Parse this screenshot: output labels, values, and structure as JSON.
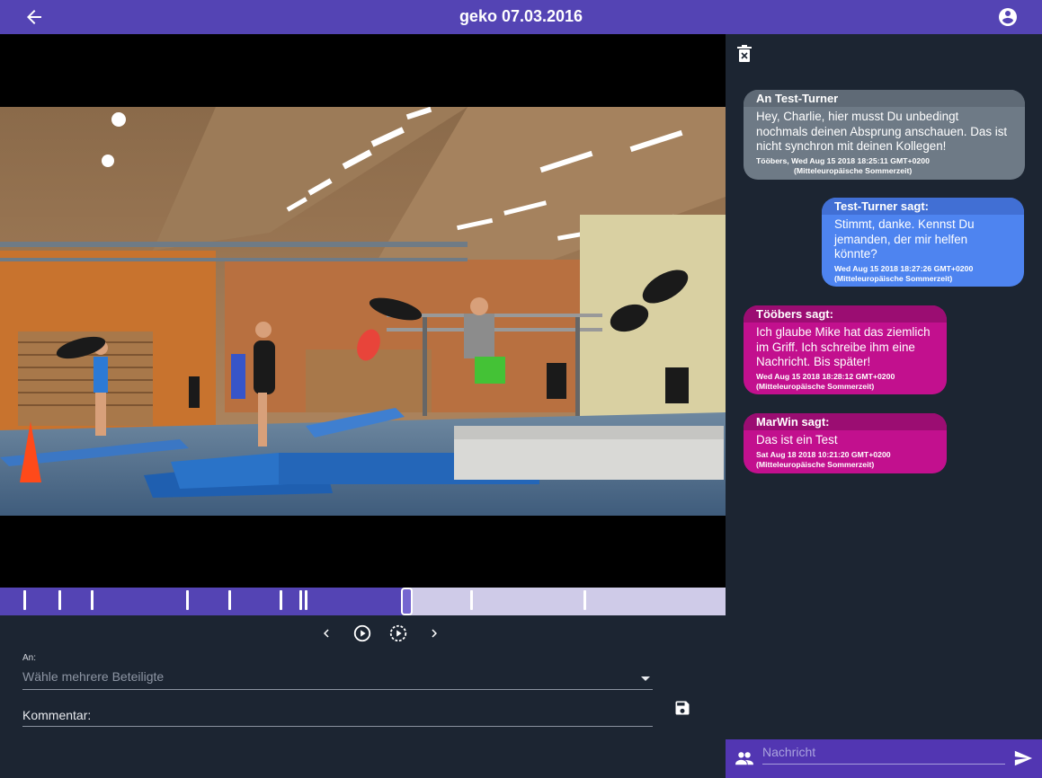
{
  "header": {
    "title": "geko 07.03.2016",
    "back_icon": "arrow-back-icon",
    "account_icon": "account-circle-icon",
    "bar_color": "#5444b4"
  },
  "player": {
    "progress": 0.565,
    "marker_positions": [
      0.032,
      0.081,
      0.125,
      0.256,
      0.315,
      0.385,
      0.413,
      0.42,
      0.648,
      0.804
    ],
    "controls": [
      "chevron-left-icon",
      "play-circle-icon",
      "play-from-circle-icon",
      "chevron-right-icon"
    ]
  },
  "form": {
    "to_label": "An:",
    "participants_placeholder": "Wähle mehrere Beteiligte",
    "comment_label": "Kommentar:",
    "save_icon": "save-icon"
  },
  "chat": {
    "delete_icon": "delete-icon",
    "messages": [
      {
        "header": "An Test-Turner",
        "text": "Hey, Charlie, hier musst Du unbedingt nochmals deinen Absprung anschauen. Das ist nicht synchron mit deinen Kollegen!",
        "meta_line1": "Tööbers, Wed Aug 15 2018 18:25:11 GMT+0200",
        "meta_line2": "(Mitteleuropäische Sommerzeit)",
        "color": "#6e7a86"
      },
      {
        "header": "Test-Turner sagt:",
        "text": "Stimmt, danke. Kennst Du jemanden, der mir helfen könnte?",
        "meta_line1": "Wed Aug 15 2018 18:27:26 GMT+0200",
        "meta_line2": "(Mitteleuropäische Sommerzeit)",
        "color": "#4e84f0"
      },
      {
        "header": "Tööbers sagt:",
        "text": "Ich glaube Mike hat das ziemlich im Griff. Ich schreibe ihm eine Nachricht. Bis später!",
        "meta_line1": "Wed Aug 15 2018 18:28:12 GMT+0200",
        "meta_line2": "(Mitteleuropäische Sommerzeit)",
        "color": "#c2108e"
      },
      {
        "header": "MarWin sagt:",
        "text": "Das ist ein Test",
        "meta_line1": "Sat Aug 18 2018 10:21:20 GMT+0200",
        "meta_line2": "(Mitteleuropäische Sommerzeit)",
        "color": "#c2108e"
      }
    ],
    "input_placeholder": "Nachricht",
    "people_icon": "people-icon",
    "send_icon": "send-icon"
  }
}
